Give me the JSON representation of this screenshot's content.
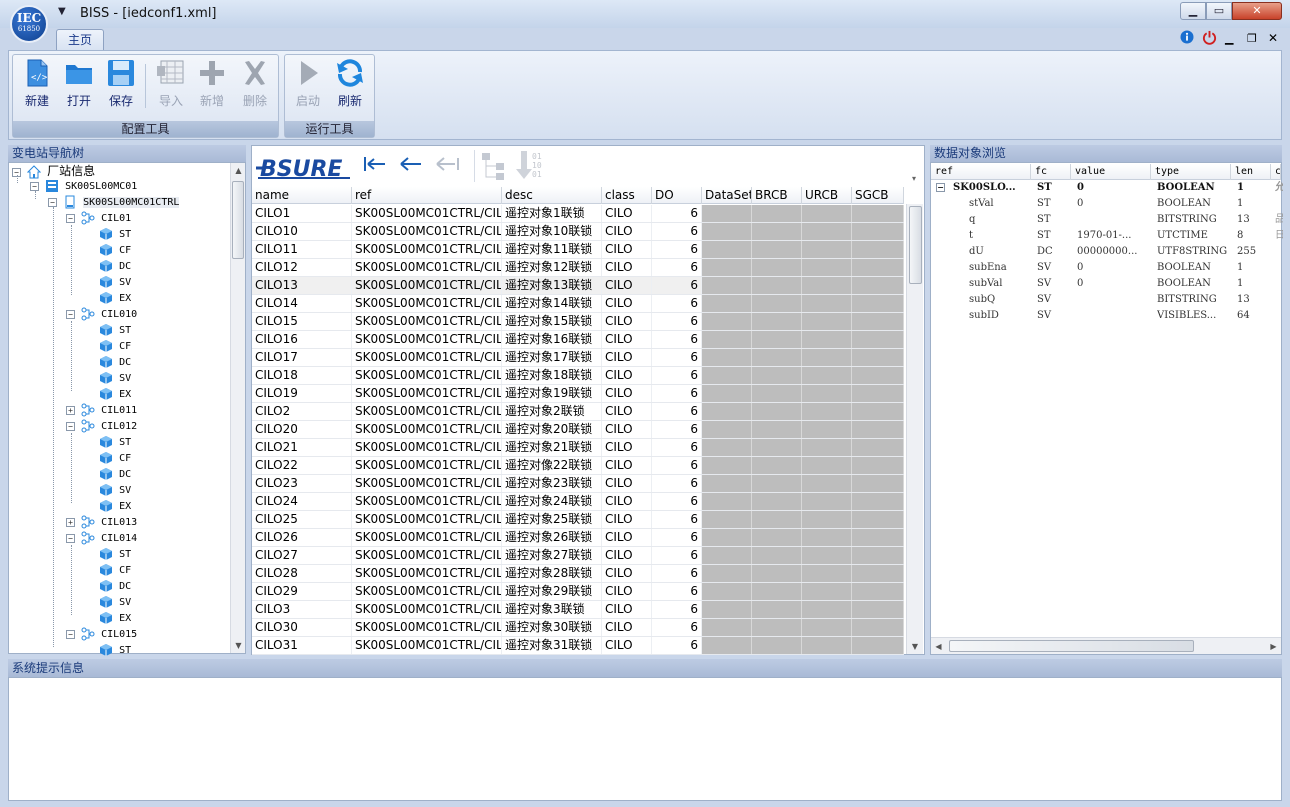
{
  "window": {
    "logo_top": "IEC",
    "logo_bottom": "61850",
    "title": "BISS - [iedconf1.xml]",
    "controls": {
      "minimize": "▁",
      "maximize": "▭",
      "close": "✕"
    }
  },
  "ribbon": {
    "tabs": [
      {
        "label": "主页",
        "active": true
      }
    ],
    "right_icons": [
      "info-icon",
      "power-icon",
      "minimize-icon",
      "restore-icon",
      "close-icon"
    ],
    "groups": [
      {
        "label": "配置工具",
        "buttons": [
          {
            "label": "新建",
            "icon": "new-file-icon",
            "enabled": true
          },
          {
            "label": "打开",
            "icon": "folder-icon",
            "enabled": true
          },
          {
            "label": "保存",
            "icon": "save-icon",
            "enabled": true
          },
          {
            "label": "导入",
            "icon": "import-icon",
            "enabled": false
          },
          {
            "label": "新增",
            "icon": "plus-icon",
            "enabled": false
          },
          {
            "label": "删除",
            "icon": "delete-icon",
            "enabled": false
          }
        ]
      },
      {
        "label": "运行工具",
        "buttons": [
          {
            "label": "启动",
            "icon": "play-icon",
            "enabled": false
          },
          {
            "label": "刷新",
            "icon": "refresh-icon",
            "enabled": true
          }
        ]
      }
    ]
  },
  "nav": {
    "title": "变电站导航树",
    "items": [
      {
        "label": "厂站信息"
      },
      {
        "label": "SK00SL00MC01"
      },
      {
        "label": "SK00SL00MC01CTRL"
      },
      {
        "label": "CIL01"
      },
      {
        "label": "ST"
      },
      {
        "label": "CF"
      },
      {
        "label": "DC"
      },
      {
        "label": "SV"
      },
      {
        "label": "EX"
      },
      {
        "label": "CIL010"
      },
      {
        "label": "ST"
      },
      {
        "label": "CF"
      },
      {
        "label": "DC"
      },
      {
        "label": "SV"
      },
      {
        "label": "EX"
      },
      {
        "label": "CIL011"
      },
      {
        "label": "CIL012"
      },
      {
        "label": "ST"
      },
      {
        "label": "CF"
      },
      {
        "label": "DC"
      },
      {
        "label": "SV"
      },
      {
        "label": "EX"
      },
      {
        "label": "CIL013"
      },
      {
        "label": "CIL014"
      },
      {
        "label": "ST"
      },
      {
        "label": "CF"
      },
      {
        "label": "DC"
      },
      {
        "label": "SV"
      },
      {
        "label": "EX"
      },
      {
        "label": "CIL015"
      },
      {
        "label": "ST"
      }
    ]
  },
  "center": {
    "brand": "BSURE",
    "nav_icons": [
      "go-first-icon",
      "go-back-icon",
      "go-back-disabled-icon",
      "structure-icon",
      "binary-download-icon"
    ],
    "columns": [
      "name",
      "ref",
      "desc",
      "class",
      "DO",
      "DataSet",
      "BRCB",
      "URCB",
      "SGCB"
    ],
    "rows": [
      {
        "name": "CILO1",
        "ref": "SK00SL00MC01CTRL/CILO",
        "desc": "遥控对象1联锁",
        "class": "CILO",
        "do": "6"
      },
      {
        "name": "CILO10",
        "ref": "SK00SL00MC01CTRL/CILO",
        "desc": "遥控对象10联锁",
        "class": "CILO",
        "do": "6"
      },
      {
        "name": "CILO11",
        "ref": "SK00SL00MC01CTRL/CILO",
        "desc": "遥控对象11联锁",
        "class": "CILO",
        "do": "6"
      },
      {
        "name": "CILO12",
        "ref": "SK00SL00MC01CTRL/CILO",
        "desc": "遥控对象12联锁",
        "class": "CILO",
        "do": "6"
      },
      {
        "name": "CILO13",
        "ref": "SK00SL00MC01CTRL/CILO",
        "desc": "遥控对象13联锁",
        "class": "CILO",
        "do": "6"
      },
      {
        "name": "CILO14",
        "ref": "SK00SL00MC01CTRL/CILO",
        "desc": "遥控对象14联锁",
        "class": "CILO",
        "do": "6"
      },
      {
        "name": "CILO15",
        "ref": "SK00SL00MC01CTRL/CILO",
        "desc": "遥控对象15联锁",
        "class": "CILO",
        "do": "6"
      },
      {
        "name": "CILO16",
        "ref": "SK00SL00MC01CTRL/CILO",
        "desc": "遥控对象16联锁",
        "class": "CILO",
        "do": "6"
      },
      {
        "name": "CILO17",
        "ref": "SK00SL00MC01CTRL/CILO",
        "desc": "遥控对象17联锁",
        "class": "CILO",
        "do": "6"
      },
      {
        "name": "CILO18",
        "ref": "SK00SL00MC01CTRL/CILO",
        "desc": "遥控对象18联锁",
        "class": "CILO",
        "do": "6"
      },
      {
        "name": "CILO19",
        "ref": "SK00SL00MC01CTRL/CILO",
        "desc": "遥控对象19联锁",
        "class": "CILO",
        "do": "6"
      },
      {
        "name": "CILO2",
        "ref": "SK00SL00MC01CTRL/CILO",
        "desc": "遥控对象2联锁",
        "class": "CILO",
        "do": "6"
      },
      {
        "name": "CILO20",
        "ref": "SK00SL00MC01CTRL/CILO",
        "desc": "遥控对象20联锁",
        "class": "CILO",
        "do": "6"
      },
      {
        "name": "CILO21",
        "ref": "SK00SL00MC01CTRL/CILO",
        "desc": "遥控对象21联锁",
        "class": "CILO",
        "do": "6"
      },
      {
        "name": "CILO22",
        "ref": "SK00SL00MC01CTRL/CILO",
        "desc": "遥控对像22联锁",
        "class": "CILO",
        "do": "6"
      },
      {
        "name": "CILO23",
        "ref": "SK00SL00MC01CTRL/CILO",
        "desc": "遥控对象23联锁",
        "class": "CILO",
        "do": "6"
      },
      {
        "name": "CILO24",
        "ref": "SK00SL00MC01CTRL/CILO",
        "desc": "遥控对象24联锁",
        "class": "CILO",
        "do": "6"
      },
      {
        "name": "CILO25",
        "ref": "SK00SL00MC01CTRL/CILO",
        "desc": "遥控对象25联锁",
        "class": "CILO",
        "do": "6"
      },
      {
        "name": "CILO26",
        "ref": "SK00SL00MC01CTRL/CILO",
        "desc": "遥控对象26联锁",
        "class": "CILO",
        "do": "6"
      },
      {
        "name": "CILO27",
        "ref": "SK00SL00MC01CTRL/CILO",
        "desc": "遥控对象27联锁",
        "class": "CILO",
        "do": "6"
      },
      {
        "name": "CILO28",
        "ref": "SK00SL00MC01CTRL/CILO",
        "desc": "遥控对象28联锁",
        "class": "CILO",
        "do": "6"
      },
      {
        "name": "CILO29",
        "ref": "SK00SL00MC01CTRL/CILO",
        "desc": "遥控对象29联锁",
        "class": "CILO",
        "do": "6"
      },
      {
        "name": "CILO3",
        "ref": "SK00SL00MC01CTRL/CILO",
        "desc": "遥控对象3联锁",
        "class": "CILO",
        "do": "6"
      },
      {
        "name": "CILO30",
        "ref": "SK00SL00MC01CTRL/CILO",
        "desc": "遥控对象30联锁",
        "class": "CILO",
        "do": "6"
      },
      {
        "name": "CILO31",
        "ref": "SK00SL00MC01CTRL/CILO",
        "desc": "遥控对象31联锁",
        "class": "CILO",
        "do": "6"
      }
    ]
  },
  "browser": {
    "title": "数据对象浏览",
    "columns": [
      "ref",
      "fc",
      "value",
      "type",
      "len",
      "c"
    ],
    "rows": [
      {
        "ref": "SK00SLO...",
        "fc": "ST",
        "value": "0",
        "type": "BOOLEAN",
        "len": "1",
        "extra": "允"
      },
      {
        "ref": "stVal",
        "fc": "ST",
        "value": "0",
        "type": "BOOLEAN",
        "len": "1",
        "extra": ""
      },
      {
        "ref": "q",
        "fc": "ST",
        "value": "",
        "type": "BITSTRING",
        "len": "13",
        "extra": "品"
      },
      {
        "ref": "t",
        "fc": "ST",
        "value": "1970-01-...",
        "type": "UTCTIME",
        "len": "8",
        "extra": "日"
      },
      {
        "ref": "dU",
        "fc": "DC",
        "value": "00000000...",
        "type": "UTF8STRING",
        "len": "255",
        "extra": ""
      },
      {
        "ref": "subEna",
        "fc": "SV",
        "value": "0",
        "type": "BOOLEAN",
        "len": "1",
        "extra": ""
      },
      {
        "ref": "subVal",
        "fc": "SV",
        "value": "0",
        "type": "BOOLEAN",
        "len": "1",
        "extra": ""
      },
      {
        "ref": "subQ",
        "fc": "SV",
        "value": "",
        "type": "BITSTRING",
        "len": "13",
        "extra": ""
      },
      {
        "ref": "subID",
        "fc": "SV",
        "value": "",
        "type": "VISIBLES...",
        "len": "64",
        "extra": ""
      }
    ]
  },
  "status": {
    "title": "系统提示信息"
  },
  "colors": {
    "accent": "#1a5fb4",
    "frame": "#c9d6ea",
    "panel_header": "#a9bad6",
    "disabled_cell": "#bdbdbd"
  }
}
